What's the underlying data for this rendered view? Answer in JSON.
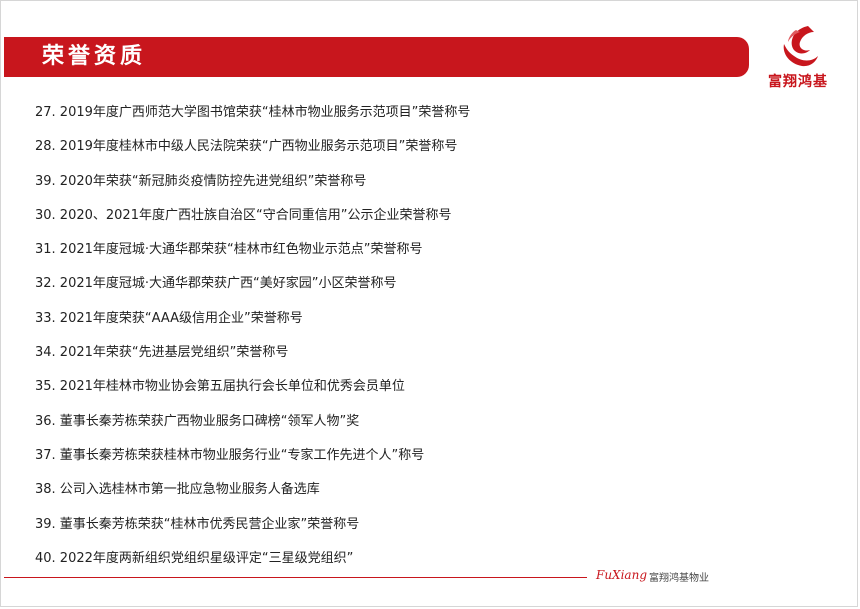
{
  "header": {
    "title": "荣誉资质"
  },
  "logo": {
    "text": "富翔鸿基",
    "mark_color": "#c8161d"
  },
  "honors": [
    "27. 2019年度广西师范大学图书馆荣获“桂林市物业服务示范项目”荣誉称号",
    "28. 2019年度桂林市中级人民法院荣获“广西物业服务示范项目”荣誉称号",
    "39. 2020年荣获“新冠肺炎疫情防控先进党组织”荣誉称号",
    "30. 2020、2021年度广西壮族自治区“守合同重信用”公示企业荣誉称号",
    "31. 2021年度冠城·大通华郡荣获“桂林市红色物业示范点”荣誉称号",
    "32. 2021年度冠城·大通华郡荣获广西“美好家园”小区荣誉称号",
    "33. 2021年度荣获“AAA级信用企业”荣誉称号",
    "34. 2021年荣获“先进基层党组织”荣誉称号",
    "35. 2021年桂林市物业协会第五届执行会长单位和优秀会员单位",
    "36. 董事长秦芳栋荣获广西物业服务口碑榜“领军人物”奖",
    "37. 董事长秦芳栋荣获桂林市物业服务行业“专家工作先进个人”称号",
    "38. 公司入选桂林市第一批应急物业服务人备选库",
    "39. 董事长秦芳栋荣获“桂林市优秀民营企业家”荣誉称号",
    "40. 2022年度两新组织党组织星级评定“三星级党组织”"
  ],
  "footer": {
    "brand": "FuXiang",
    "company": "富翔鸿基物业"
  },
  "colors": {
    "accent": "#c8161d",
    "text": "#222222"
  }
}
